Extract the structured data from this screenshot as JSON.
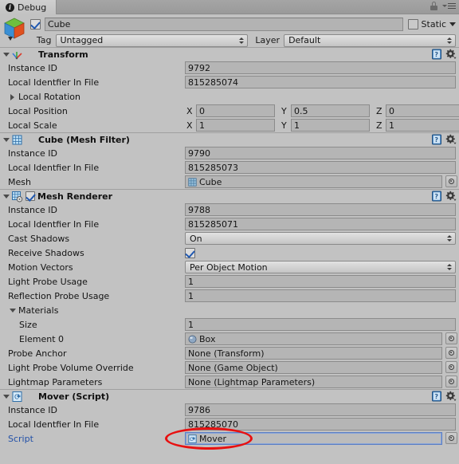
{
  "window": {
    "tab_label": "Debug",
    "tab_icon": "info-icon",
    "lock_icon": "lock-icon",
    "menu_icon": "hamburger-menu-icon"
  },
  "gameobject": {
    "icon": "cube-gameobject-icon",
    "enabled": true,
    "name": "Cube",
    "static_label": "Static",
    "static_checked": false,
    "tag_label": "Tag",
    "tag_value": "Untagged",
    "layer_label": "Layer",
    "layer_value": "Default"
  },
  "components": [
    {
      "id": "transform",
      "title": "Transform",
      "icon": "transform-gizmo-icon",
      "has_toggle": false,
      "expanded": true,
      "rows": [
        {
          "type": "text",
          "label": "Instance ID",
          "value": "9792"
        },
        {
          "type": "text",
          "label": "Local Identfier In File",
          "value": "815285074"
        },
        {
          "type": "fold",
          "label": "Local Rotation",
          "expanded": false
        },
        {
          "type": "vec3",
          "label": "Local Position",
          "axes": [
            "X",
            "Y",
            "Z"
          ],
          "values": [
            "0",
            "0.5",
            "0"
          ]
        },
        {
          "type": "vec3",
          "label": "Local Scale",
          "axes": [
            "X",
            "Y",
            "Z"
          ],
          "values": [
            "1",
            "1",
            "1"
          ]
        }
      ]
    },
    {
      "id": "mesh-filter",
      "title": "Cube (Mesh Filter)",
      "icon": "mesh-filter-icon",
      "has_toggle": false,
      "expanded": true,
      "rows": [
        {
          "type": "text",
          "label": "Instance ID",
          "value": "9790"
        },
        {
          "type": "text",
          "label": "Local Identfier In File",
          "value": "815285073"
        },
        {
          "type": "object",
          "label": "Mesh",
          "value": "Cube",
          "object_icon": "mesh-asset-icon"
        }
      ]
    },
    {
      "id": "mesh-renderer",
      "title": "Mesh Renderer",
      "icon": "mesh-renderer-icon",
      "has_toggle": true,
      "toggle_checked": true,
      "expanded": true,
      "rows": [
        {
          "type": "text",
          "label": "Instance ID",
          "value": "9788"
        },
        {
          "type": "text",
          "label": "Local Identfier In File",
          "value": "815285071"
        },
        {
          "type": "dropdown",
          "label": "Cast Shadows",
          "value": "On"
        },
        {
          "type": "checkbox",
          "label": "Receive Shadows",
          "checked": true
        },
        {
          "type": "dropdown",
          "label": "Motion Vectors",
          "value": "Per Object Motion"
        },
        {
          "type": "text",
          "label": "Light Probe Usage",
          "value": "1"
        },
        {
          "type": "text",
          "label": "Reflection Probe Usage",
          "value": "1"
        },
        {
          "type": "fold",
          "label": "Materials",
          "expanded": true
        },
        {
          "type": "text",
          "label": "Size",
          "value": "1",
          "indent": 1
        },
        {
          "type": "object",
          "label": "Element 0",
          "value": "Box",
          "object_icon": "material-asset-icon",
          "indent": 1
        },
        {
          "type": "object",
          "label": "Probe Anchor",
          "value": "None (Transform)"
        },
        {
          "type": "object",
          "label": "Light Probe Volume Override",
          "value": "None (Game Object)"
        },
        {
          "type": "object",
          "label": "Lightmap Parameters",
          "value": "None (Lightmap Parameters)"
        }
      ]
    },
    {
      "id": "mover-script",
      "title": "Mover (Script)",
      "icon": "csharp-script-icon",
      "has_toggle": false,
      "expanded": true,
      "rows": [
        {
          "type": "text",
          "label": "Instance ID",
          "value": "9786"
        },
        {
          "type": "text",
          "label": "Local Identfier In File",
          "value": "815285070"
        },
        {
          "type": "object",
          "label": "Script",
          "value": "Mover",
          "object_icon": "csharp-script-icon",
          "label_blue": true,
          "focused": true,
          "annotated": true
        }
      ]
    }
  ],
  "annotation": {
    "shape": "ellipse",
    "color": "#e81010",
    "target": "script-field-mover"
  }
}
